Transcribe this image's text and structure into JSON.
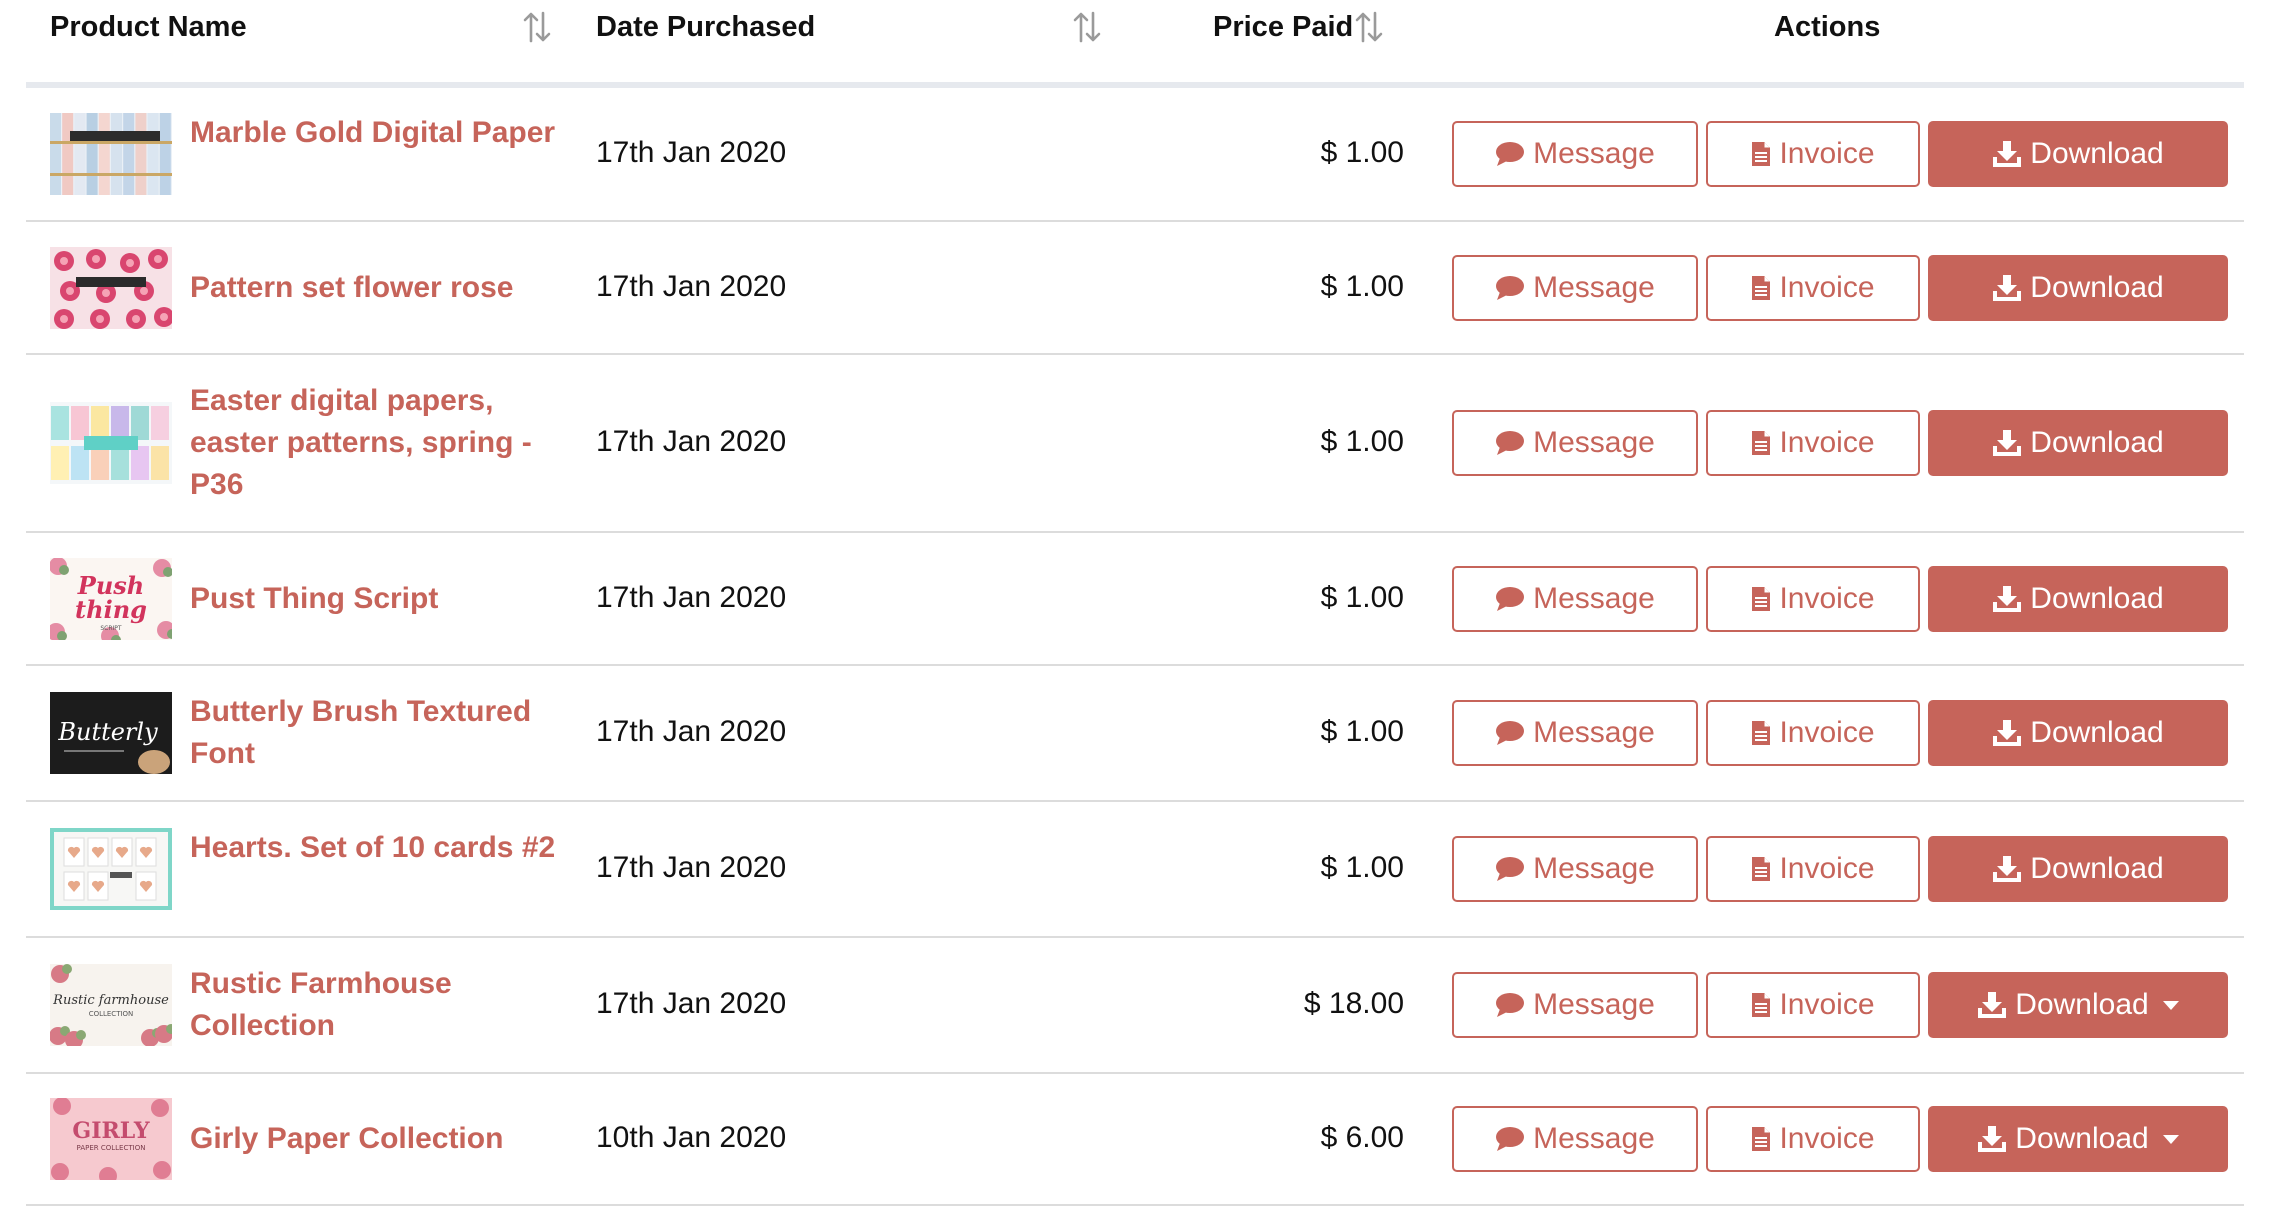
{
  "columns": {
    "product": "Product Name",
    "date": "Date Purchased",
    "price": "Price Paid",
    "actions": "Actions"
  },
  "buttons": {
    "message": "Message",
    "invoice": "Invoice",
    "download": "Download"
  },
  "accent_color": "#c6645a",
  "icons": {
    "sort": "sort-arrows-icon",
    "message": "chat-bubble-icon",
    "invoice": "document-icon",
    "download": "download-tray-icon",
    "dropdown": "caret-down-icon"
  },
  "rows": [
    {
      "name": "Marble Gold Digital Paper",
      "date": "17th Jan 2020",
      "price": "$ 1.00",
      "download_dropdown": false
    },
    {
      "name": "Pattern set flower rose",
      "date": "17th Jan 2020",
      "price": "$ 1.00",
      "download_dropdown": false
    },
    {
      "name": "Easter digital papers, easter patterns, spring - P36",
      "date": "17th Jan 2020",
      "price": "$ 1.00",
      "download_dropdown": false
    },
    {
      "name": "Pust Thing Script",
      "date": "17th Jan 2020",
      "price": "$ 1.00",
      "download_dropdown": false,
      "thumb_text": [
        "Push",
        "thing",
        "SCRIPT"
      ]
    },
    {
      "name": "Butterly Brush Textured Font",
      "date": "17th Jan 2020",
      "price": "$ 1.00",
      "download_dropdown": false,
      "thumb_text": [
        "Butterly"
      ]
    },
    {
      "name": "Hearts. Set of 10 cards #2",
      "date": "17th Jan 2020",
      "price": "$ 1.00",
      "download_dropdown": false
    },
    {
      "name": "Rustic Farmhouse Collection",
      "date": "17th Jan 2020",
      "price": "$ 18.00",
      "download_dropdown": true,
      "thumb_text": [
        "Rustic farmhouse",
        "COLLECTION"
      ]
    },
    {
      "name": "Girly Paper Collection",
      "date": "10th Jan 2020",
      "price": "$ 6.00",
      "download_dropdown": true,
      "thumb_text": [
        "GIRLY",
        "PAPER COLLECTION"
      ]
    }
  ]
}
